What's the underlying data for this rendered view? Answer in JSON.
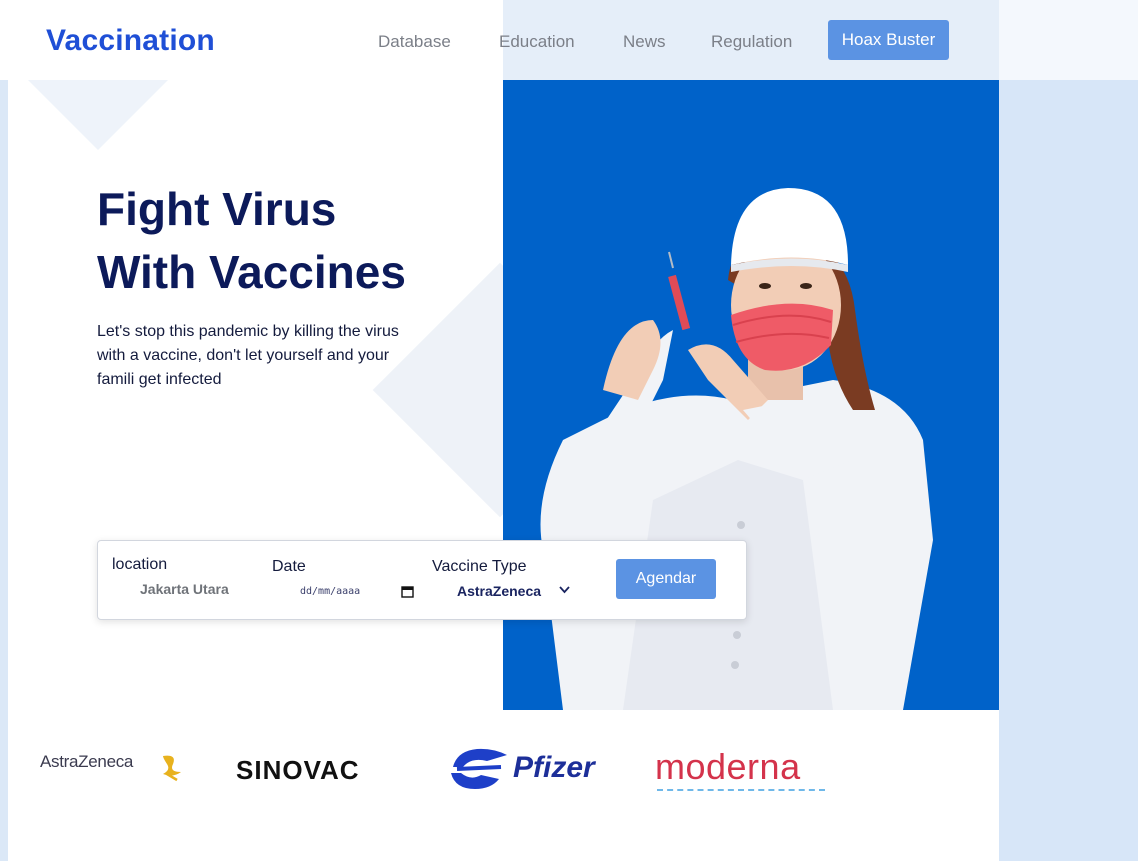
{
  "brand": {
    "logo": "Vaccination"
  },
  "nav": {
    "links": [
      "Database",
      "Education",
      "News",
      "Regulation"
    ],
    "cta": "Hoax Buster"
  },
  "hero": {
    "title_line1": "Fight Virus",
    "title_line2": "With Vaccines",
    "description": "Let's stop this pandemic by killing the virus with a vaccine, don't let yourself and your famili get infected"
  },
  "search": {
    "location_label": "location",
    "location_value": "Jakarta Utara",
    "date_label": "Date",
    "date_placeholder": "dd/mm/aaaa",
    "type_label": "Vaccine Type",
    "type_value": "AstraZeneca",
    "submit": "Agendar"
  },
  "brands": [
    "AstraZeneca",
    "SINOVAC",
    "Pfizer",
    "moderna"
  ],
  "colors": {
    "accent": "#5b93e3",
    "logo": "#1f4fd6",
    "heading": "#0c1a5a",
    "photo_bg": "#0062c9"
  }
}
